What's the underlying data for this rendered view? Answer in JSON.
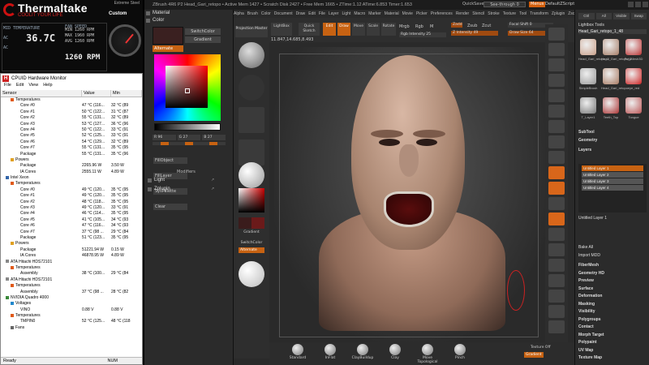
{
  "thermaltake": {
    "brand": "Thermaltake",
    "tagline": "COOLIT YOUR LIFE",
    "extreme": "Extreme Steel",
    "custom": "Custom",
    "cpu_labels": [
      "MID TEMPERATURE",
      "AC",
      "AC"
    ],
    "cpu_temp": "36.7C",
    "fan_label": "FAN SPEED",
    "fan_lines": [
      "MIN  1260 RPM",
      "MAX  1960 RPM",
      "AVG  1260 RPM"
    ],
    "rpm": "1260 RPM"
  },
  "hwmonitor": {
    "title": "CPUID Hardware Monitor",
    "menu": [
      "File",
      "Edit",
      "View",
      "Help"
    ],
    "columns": [
      "Sensor",
      "Value",
      "Min"
    ],
    "rows": [
      {
        "name": "Temperatures",
        "indent": 2,
        "kind": "temp",
        "value": "",
        "min": ""
      },
      {
        "name": "Core #0",
        "indent": 4,
        "kind": "",
        "value": "47 °C (116...",
        "min": "32 °C (89"
      },
      {
        "name": "Core #1",
        "indent": 4,
        "kind": "",
        "value": "50 °C (122...",
        "min": "31 °C (87"
      },
      {
        "name": "Core #2",
        "indent": 4,
        "kind": "",
        "value": "55 °C (131...",
        "min": "32 °C (89"
      },
      {
        "name": "Core #3",
        "indent": 4,
        "kind": "",
        "value": "53 °C (127...",
        "min": "36 °C (96"
      },
      {
        "name": "Core #4",
        "indent": 4,
        "kind": "",
        "value": "50 °C (122...",
        "min": "33 °C (91"
      },
      {
        "name": "Core #5",
        "indent": 4,
        "kind": "",
        "value": "52 °C (125...",
        "min": "33 °C (91"
      },
      {
        "name": "Core #6",
        "indent": 4,
        "kind": "",
        "value": "54 °C (129...",
        "min": "32 °C (89"
      },
      {
        "name": "Core #7",
        "indent": 4,
        "kind": "",
        "value": "55 °C (131...",
        "min": "35 °C (95"
      },
      {
        "name": "Package",
        "indent": 4,
        "kind": "",
        "value": "55 °C (131...",
        "min": "35 °C (96"
      },
      {
        "name": "Powers",
        "indent": 2,
        "kind": "power",
        "value": "",
        "min": ""
      },
      {
        "name": "Package",
        "indent": 4,
        "kind": "",
        "value": "2265.96 W",
        "min": "3.50 W"
      },
      {
        "name": "IA Cores",
        "indent": 4,
        "kind": "",
        "value": "2555.11 W",
        "min": "4.89 W"
      },
      {
        "name": "Intel Xeon",
        "indent": 1,
        "kind": "chip",
        "value": "",
        "min": ""
      },
      {
        "name": "Temperatures",
        "indent": 2,
        "kind": "temp",
        "value": "",
        "min": ""
      },
      {
        "name": "Core #0",
        "indent": 4,
        "kind": "",
        "value": "49 °C (120...",
        "min": "35 °C (95"
      },
      {
        "name": "Core #1",
        "indent": 4,
        "kind": "",
        "value": "49 °C (120...",
        "min": "35 °C (95"
      },
      {
        "name": "Core #2",
        "indent": 4,
        "kind": "",
        "value": "48 °C (118...",
        "min": "35 °C (95"
      },
      {
        "name": "Core #3",
        "indent": 4,
        "kind": "",
        "value": "49 °C (120...",
        "min": "33 °C (91"
      },
      {
        "name": "Core #4",
        "indent": 4,
        "kind": "",
        "value": "46 °C (114...",
        "min": "35 °C (95"
      },
      {
        "name": "Core #5",
        "indent": 4,
        "kind": "",
        "value": "41 °C (105...",
        "min": "34 °C (93"
      },
      {
        "name": "Core #6",
        "indent": 4,
        "kind": "",
        "value": "47 °C (116...",
        "min": "34 °C (93"
      },
      {
        "name": "Core #7",
        "indent": 4,
        "kind": "",
        "value": "37 °C (98 ...",
        "min": "29 °C (84"
      },
      {
        "name": "Package",
        "indent": 4,
        "kind": "",
        "value": "51 °C (123...",
        "min": "35 °C (95"
      },
      {
        "name": "Powers",
        "indent": 2,
        "kind": "power",
        "value": "",
        "min": ""
      },
      {
        "name": "Package",
        "indent": 4,
        "kind": "",
        "value": "51221.94 W",
        "min": "0.15 W"
      },
      {
        "name": "IA Cores",
        "indent": 4,
        "kind": "",
        "value": "46878.95 W",
        "min": "4.89 W"
      },
      {
        "name": "ATA Hitachi HDS72101",
        "indent": 1,
        "kind": "disk",
        "value": "",
        "min": ""
      },
      {
        "name": "Temperatures",
        "indent": 2,
        "kind": "temp",
        "value": "",
        "min": ""
      },
      {
        "name": "Assembly",
        "indent": 4,
        "kind": "",
        "value": "38 °C (100...",
        "min": "29 °C (84"
      },
      {
        "name": "ATA Hitachi HDS72101",
        "indent": 1,
        "kind": "disk",
        "value": "",
        "min": ""
      },
      {
        "name": "Temperatures",
        "indent": 2,
        "kind": "temp",
        "value": "",
        "min": ""
      },
      {
        "name": "Assembly",
        "indent": 4,
        "kind": "",
        "value": "37 °C (98 ...",
        "min": "28 °C (82"
      },
      {
        "name": "NVIDIA Quadro 4000",
        "indent": 1,
        "kind": "gpu",
        "value": "",
        "min": ""
      },
      {
        "name": "Voltages",
        "indent": 2,
        "kind": "volt",
        "value": "",
        "min": ""
      },
      {
        "name": "VINO",
        "indent": 4,
        "kind": "",
        "value": "0.88 V",
        "min": "0.88 V"
      },
      {
        "name": "Temperatures",
        "indent": 2,
        "kind": "temp",
        "value": "",
        "min": ""
      },
      {
        "name": "TMPIN0",
        "indent": 4,
        "kind": "",
        "value": "52 °C (125...",
        "min": "48 °C (118"
      },
      {
        "name": "Fans",
        "indent": 2,
        "kind": "fan",
        "value": "",
        "min": ""
      }
    ],
    "status": "Ready",
    "num": "NUM"
  },
  "zbrush": {
    "title": "ZBrush 4R6 P2   Head_Gari_retopo   • Active Mem 1427 • Scratch Disk 2427 • Free Mem 1665 • ZTime:1.12 ATime:6.853 Timer:1.653",
    "quicksave": "QuickSave",
    "see_through": "See-through 0",
    "menus_btn": "Menus",
    "default_script": "DefaultZScript",
    "menubar": [
      "Alpha",
      "Brush",
      "Color",
      "Document",
      "Draw",
      "Edit",
      "File",
      "Layer",
      "Light",
      "Macro",
      "Marker",
      "Material",
      "Movie",
      "Picker",
      "Preferences",
      "Render",
      "Stencil",
      "Stroke",
      "Texture",
      "Tool",
      "Transform",
      "Zplugin",
      "Zscript"
    ],
    "left_tray": {
      "material": "Material",
      "color": "Color",
      "switch_color": "SwitchColor",
      "gradient": "Gradient",
      "alternate": "Alternate",
      "r": "R 96",
      "g": "G 27",
      "b": "B 27",
      "fill_object": "FillObject",
      "fill_layer": "FillLayer",
      "sys_palette": "SysPalette",
      "clear": "Clear",
      "modifiers": "Modifiers",
      "light": "Light",
      "zplugin": "Zplugin"
    },
    "shelf": {
      "projection_master": "Projection Master",
      "lightbox": "LightBox",
      "quick_sketch": "Quick Sketch",
      "gradient": "Gradient",
      "switch_color": "SwitchColor",
      "alternate": "Alternate",
      "c0": "#3a1c1c",
      "c1": "#6b1a1a"
    },
    "toolbar": {
      "edit": "Edit",
      "draw": "Draw",
      "move": "Move",
      "scale": "Scale",
      "rotate": "Rotate",
      "mrgb": "Mrgb",
      "rgb": "Rgb",
      "m": "M",
      "zadd": "Zadd",
      "zsub": "Zsub",
      "zcut": "Zcut",
      "focal_shift": "Focal Shift 0",
      "z_intensity": "Z Intensity 49",
      "draw_size": "Draw Size 64",
      "rgb_intensity": "Rgb Intensity 25",
      "coords": "11.847,14.685,8.493"
    },
    "brushes": [
      "Standard",
      "InFlat",
      "ClayBuildup",
      "Clay",
      "Move Topological",
      "Pinch"
    ],
    "texture": "Texture Off",
    "gradient": "Gradient",
    "right_tray": {
      "tabs": [
        "Ctrl",
        "All",
        "Visible",
        "Swap"
      ],
      "lightbox_tools": "Lightbox Tools",
      "current": "Head_Gari_retopo_1_48",
      "thumb_labels": [
        "Head_Gari_retopo_1",
        "Head_Gari_retopo_1",
        "PolyMesh3D",
        "SimpleBrush",
        "Head_Gari_retopo",
        "eye_red",
        "T_Layer1",
        "Teeth_Top",
        "Tongue"
      ],
      "subtool": "SubTool",
      "geometry": "Geometry",
      "layers": "Layers",
      "layer_items": [
        "Untitled Layer 1",
        "Untitled Layer 2",
        "Untitled Layer 3",
        "Untitled Layer 4"
      ],
      "active_layer": "Untitled Layer 1",
      "bake_all": "Bake All",
      "import_mdd": "Import MDD",
      "sections": [
        "FiberMesh",
        "Geometry HD",
        "Preview",
        "Surface",
        "Deformation",
        "Masking",
        "Visibility",
        "Polygroups",
        "Contact",
        "Morph Target",
        "Polypaint",
        "UV Map",
        "Texture Map"
      ]
    }
  },
  "colors": {
    "accent": "#c76212",
    "zbrush_bg": "#2a2a2a"
  }
}
